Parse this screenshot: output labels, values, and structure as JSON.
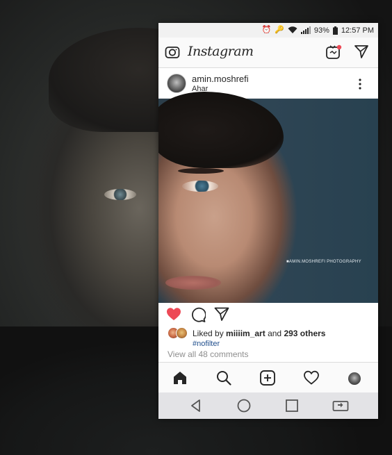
{
  "status_bar": {
    "battery": "93%",
    "time": "12:57 PM"
  },
  "header": {
    "brand": "Instagram",
    "icons": [
      "camera-icon",
      "igtv-icon",
      "direct-message-icon"
    ],
    "notification_dot_color": "#ed4956"
  },
  "post": {
    "username": "amin.moshrefi",
    "location": "Ahar",
    "image_watermark": "■AMIN.MOSHREFI PHOTOGRAPHY",
    "liked": true,
    "heart_color": "#ed4956",
    "likes_prefix": "Liked by ",
    "liked_by_user": "miiiim_art",
    "likes_and": " and ",
    "likes_others": "293 others",
    "hashtag": "#nofilter",
    "view_comments": "View all 48 comments"
  },
  "bottom_nav": {
    "items": [
      "home-icon",
      "search-icon",
      "add-post-icon",
      "activity-heart-icon",
      "profile-avatar"
    ]
  },
  "android_nav": {
    "items": [
      "back-icon",
      "home-circle-icon",
      "recents-icon",
      "rotate-screen-icon"
    ]
  }
}
